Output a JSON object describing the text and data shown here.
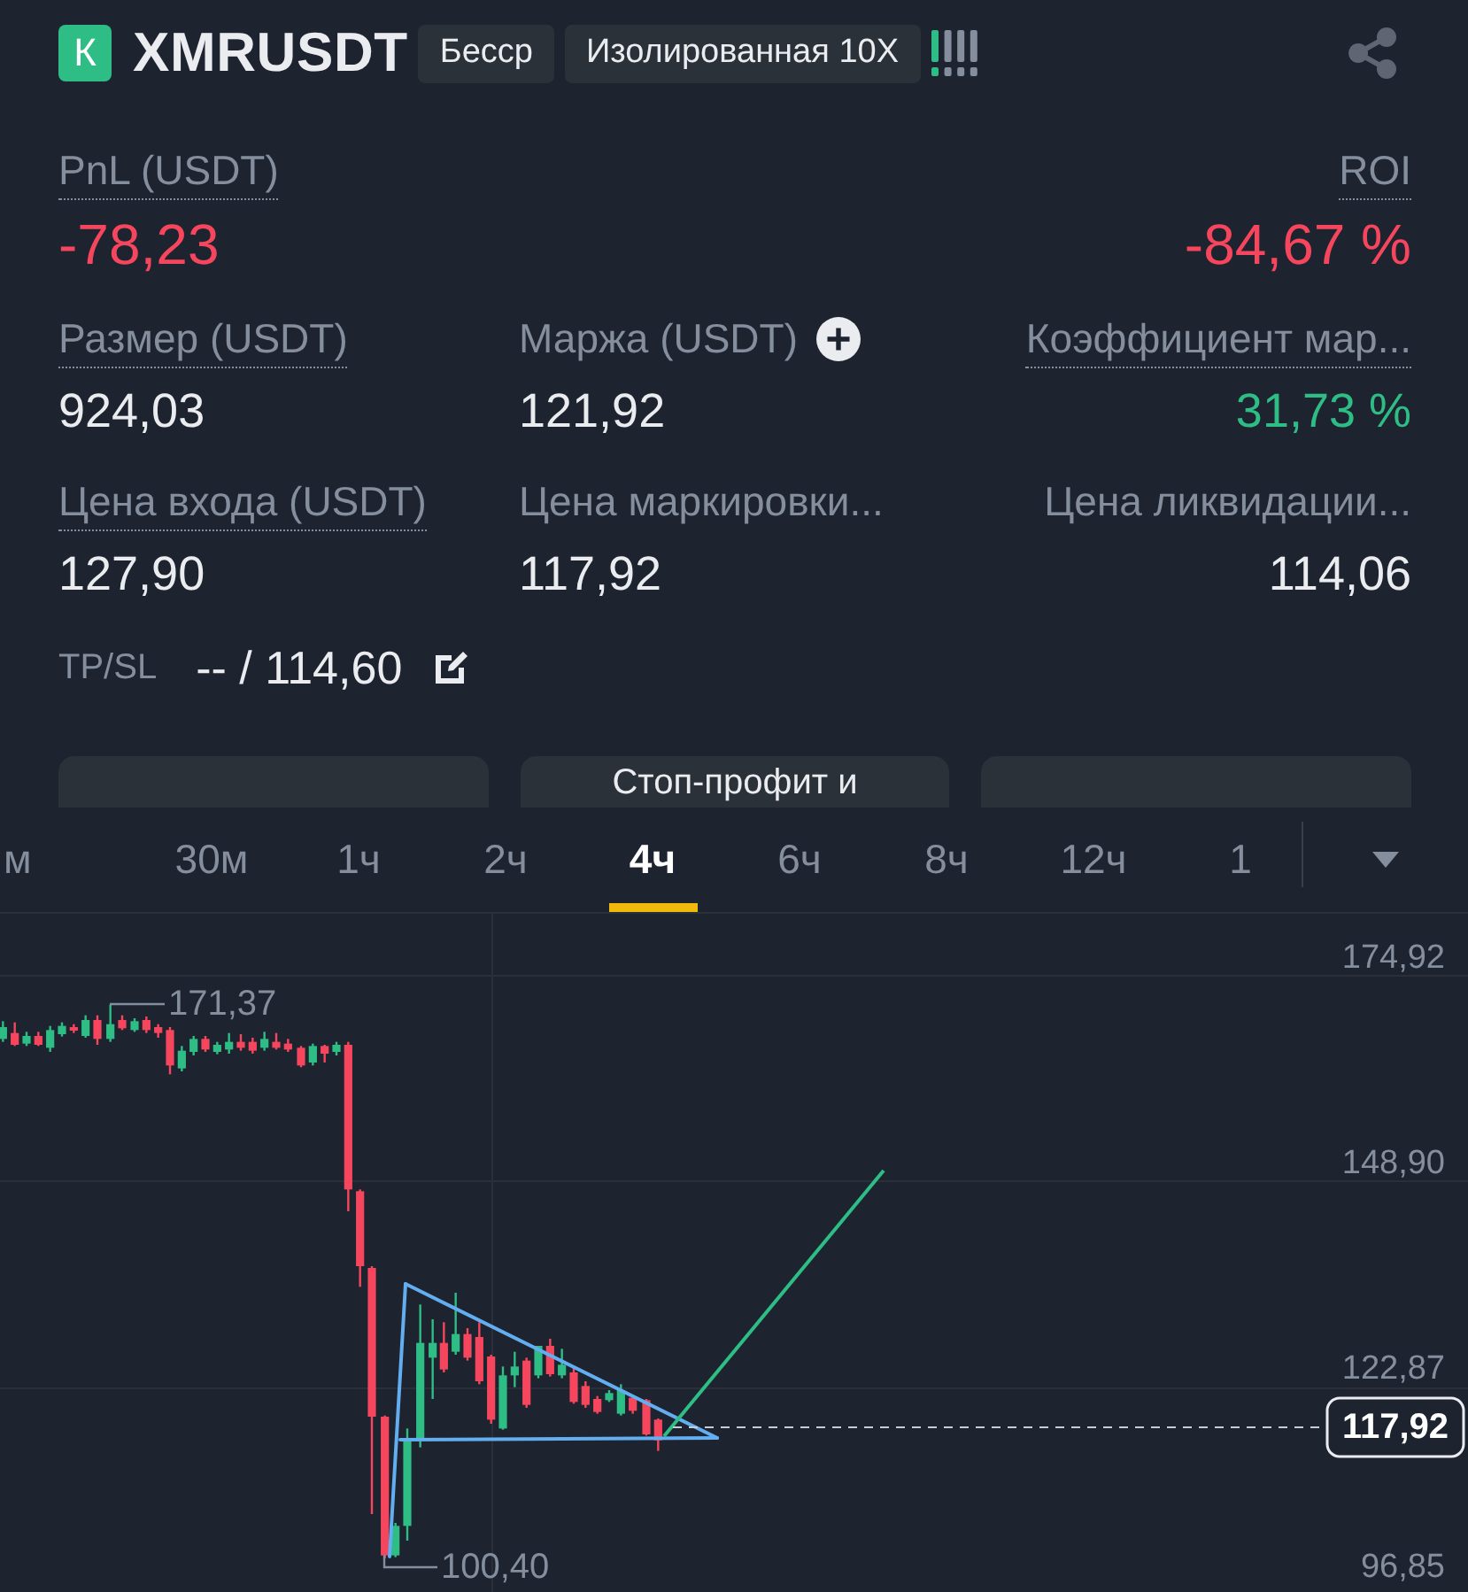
{
  "header": {
    "side_badge": "К",
    "symbol": "XMRUSDT",
    "tags": [
      "Бесср",
      "Изолированная 10X"
    ]
  },
  "summary": [
    {
      "label": "PnL (USDT)",
      "value": "-78,23",
      "underlined": true,
      "color": "#f6465d"
    },
    {
      "label": "ROI",
      "value": "-84,67 %",
      "underlined": true,
      "color": "#f6465d"
    }
  ],
  "stats": [
    {
      "label": "Размер (USDT)",
      "value": "924,03",
      "underlined": true,
      "color": "#eaecef",
      "add_button": false
    },
    {
      "label": "Маржа (USDT)",
      "value": "121,92",
      "underlined": false,
      "color": "#eaecef",
      "add_button": true
    },
    {
      "label": "Коэффициент мар...",
      "value": "31,73 %",
      "underlined": true,
      "color": "#2ebd85",
      "add_button": false
    },
    {
      "label": "Цена входа (USDT)",
      "value": "127,90",
      "underlined": true,
      "color": "#eaecef",
      "add_button": false
    },
    {
      "label": "Цена маркировки...",
      "value": "117,92",
      "underlined": false,
      "color": "#eaecef",
      "add_button": false
    },
    {
      "label": "Цена ликвидации...",
      "value": "114,06",
      "underlined": false,
      "color": "#eaecef",
      "add_button": false
    }
  ],
  "tpsl": {
    "label": "TP/SL",
    "value": "-- / 114,60"
  },
  "action_buttons": [
    {
      "kind": "blank"
    },
    {
      "kind": "text",
      "label": "Стоп-профит и"
    },
    {
      "kind": "blank"
    }
  ],
  "timeframes": [
    {
      "label": "м",
      "selected": false
    },
    {
      "label": "30м",
      "selected": false
    },
    {
      "label": "1ч",
      "selected": false
    },
    {
      "label": "2ч",
      "selected": false
    },
    {
      "label": "4ч",
      "selected": true
    },
    {
      "label": "6ч",
      "selected": false
    },
    {
      "label": "8ч",
      "selected": false
    },
    {
      "label": "12ч",
      "selected": false
    },
    {
      "label": "1",
      "selected": false
    }
  ],
  "chart": {
    "y_axis_labels": [
      "174,92",
      "148,90",
      "122,87",
      "96,85"
    ],
    "high_label": "171,37",
    "low_label": "100,40",
    "last_price": "117,92"
  }
}
